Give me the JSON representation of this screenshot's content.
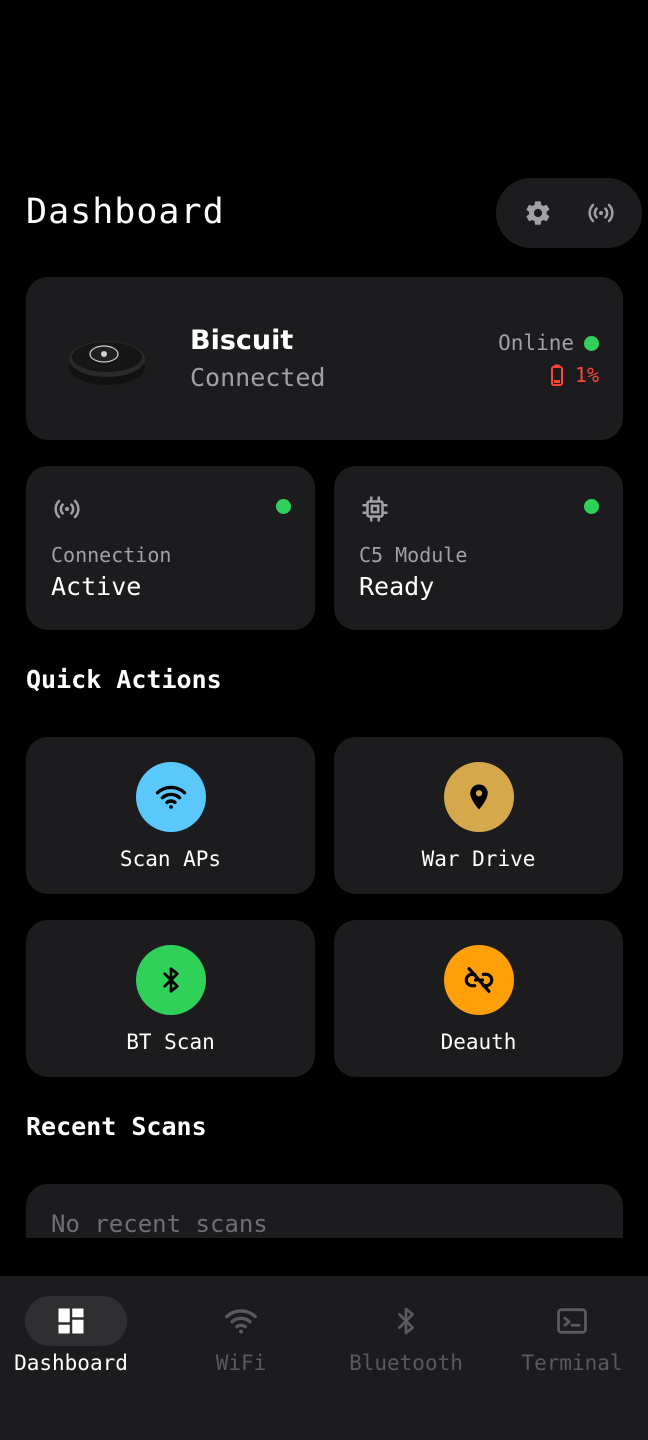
{
  "header": {
    "title": "Dashboard",
    "settings_icon": "gear-icon",
    "broadcast_icon": "broadcast-icon"
  },
  "device": {
    "name": "Biscuit",
    "status": "Connected",
    "online_label": "Online",
    "battery": "1%",
    "colors": {
      "online": "#30d158",
      "battery": "#ff453a"
    }
  },
  "stats": [
    {
      "icon": "broadcast-icon",
      "label": "Connection",
      "value": "Active"
    },
    {
      "icon": "chip-icon",
      "label": "C5 Module",
      "value": "Ready"
    }
  ],
  "quick_actions": {
    "title": "Quick Actions",
    "items": [
      {
        "label": "Scan APs",
        "icon": "wifi-icon",
        "color": "#5ac8fa"
      },
      {
        "label": "War Drive",
        "icon": "location-pin-icon",
        "color": "#d4a84b"
      },
      {
        "label": "BT Scan",
        "icon": "bluetooth-icon",
        "color": "#30d158"
      },
      {
        "label": "Deauth",
        "icon": "link-off-icon",
        "color": "#ff9f0a"
      }
    ]
  },
  "recent_scans": {
    "title": "Recent Scans",
    "empty_text": "No recent scans"
  },
  "nav": [
    {
      "label": "Dashboard",
      "icon": "dashboard-icon",
      "active": true
    },
    {
      "label": "WiFi",
      "icon": "wifi-icon",
      "active": false
    },
    {
      "label": "Bluetooth",
      "icon": "bluetooth-icon",
      "active": false
    },
    {
      "label": "Terminal",
      "icon": "terminal-icon",
      "active": false
    }
  ]
}
